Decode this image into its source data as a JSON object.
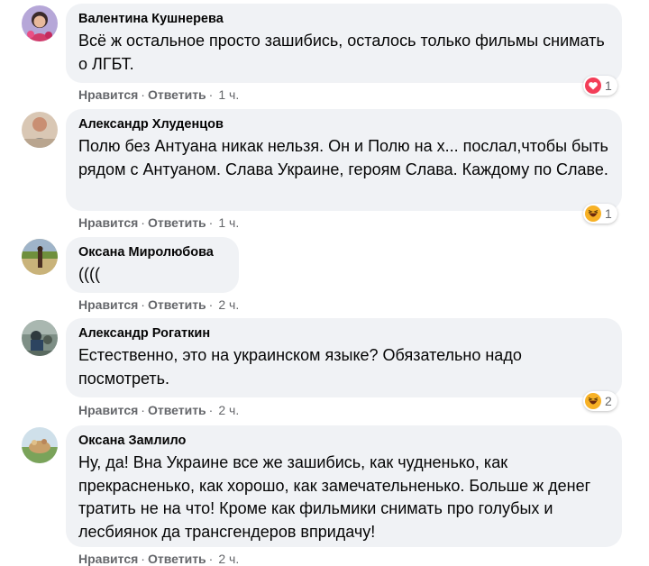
{
  "comments": [
    {
      "author": "Валентина Кушнерева",
      "text": "Всё ж остальное просто зашибись, осталось только фильмы снимать о ЛГБТ.",
      "like": "Нравится",
      "reply": "Ответить",
      "time": "1 ч.",
      "reaction": {
        "icon": "love-icon",
        "count": "1"
      }
    },
    {
      "author": "Александр Хлуденцов",
      "text": "Полю без Антуана никак нельзя. Он и Полю на х... послал,чтобы быть рядом с Антуаном. Слава Украине, героям Слава. Каждому по Славе.",
      "like": "Нравится",
      "reply": "Ответить",
      "time": "1 ч.",
      "reaction": {
        "icon": "haha-icon",
        "count": "1"
      }
    },
    {
      "author": "Оксана Миролюбова",
      "text": "((((",
      "like": "Нравится",
      "reply": "Ответить",
      "time": "2 ч."
    },
    {
      "author": "Александр Рогаткин",
      "text": "Естественно, это на украинском языке? Обязательно надо посмотреть.",
      "like": "Нравится",
      "reply": "Ответить",
      "time": "2 ч.",
      "reaction": {
        "icon": "haha-icon",
        "count": "2"
      }
    },
    {
      "author": "Оксана Замлило",
      "text": "Ну, да! Вна Украине все же зашибись, как чудненько, как прекрасненько, как хорошо, как замечательненько. Больше ж денег тратить не на что! Кроме как фильмики снимать про голубых и лесбиянок да трансгендеров впридачу!",
      "like": "Нравится",
      "reply": "Ответить",
      "time": "2 ч."
    }
  ],
  "colors": {
    "bubble": "#f0f2f5",
    "meta": "#65676b",
    "love": "#f33e58",
    "haha": "#f7b125"
  }
}
